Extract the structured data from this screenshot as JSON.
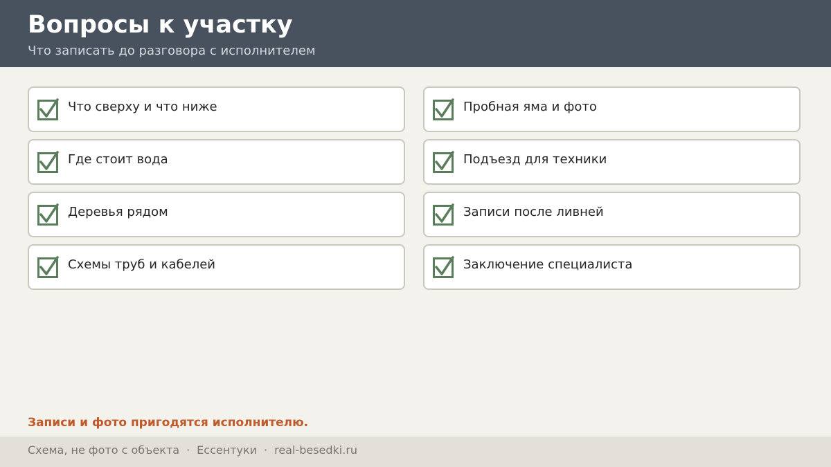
{
  "header": {
    "title": "Вопросы к участку",
    "subtitle": "Что записать до разговора с исполнителем"
  },
  "checklist": {
    "icon": "checkmark-icon",
    "check_color": "#5a7d5c",
    "items": [
      {
        "label": "Что сверху и что ниже",
        "checked": true
      },
      {
        "label": "Пробная яма и фото",
        "checked": true
      },
      {
        "label": "Где стоит вода",
        "checked": true
      },
      {
        "label": "Подъезд для техники",
        "checked": true
      },
      {
        "label": "Деревья рядом",
        "checked": true
      },
      {
        "label": "Записи после ливней",
        "checked": true
      },
      {
        "label": "Схемы труб и кабелей",
        "checked": true
      },
      {
        "label": "Заключение специалиста",
        "checked": true
      }
    ]
  },
  "note": {
    "text": "Записи и фото пригодятся исполнителю.",
    "color": "#bf5a2a"
  },
  "footer": {
    "parts": [
      "Схема, не фото с объекта",
      "Ессентуки",
      "real-besedki.ru"
    ],
    "separator": "·"
  }
}
